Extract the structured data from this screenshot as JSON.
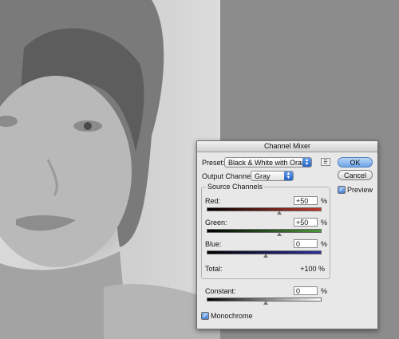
{
  "dialog": {
    "title": "Channel Mixer",
    "preset_label": "Preset:",
    "preset_value": "Black & White with Oran",
    "output_label": "Output Channel:",
    "output_value": "Gray",
    "ok_label": "OK",
    "cancel_label": "Cancel",
    "preview_label": "Preview",
    "preview_checked": true,
    "source_channels_title": "Source Channels",
    "channels": [
      {
        "label": "Red:",
        "value": "+50",
        "unit": "%",
        "level": 50
      },
      {
        "label": "Green:",
        "value": "+50",
        "unit": "%",
        "level": 50
      },
      {
        "label": "Blue:",
        "value": "0",
        "unit": "%",
        "level": 0
      }
    ],
    "total_label": "Total:",
    "total_value": "+100 %",
    "constant_label": "Constant:",
    "constant_value": "0",
    "constant_unit": "%",
    "monochrome_label": "Monochrome",
    "monochrome_checked": true
  },
  "colors": {
    "accent": "#3a78d8",
    "red_slider": "#c0392b",
    "green_slider": "#4c9a3a",
    "blue_slider": "#2c2f9a"
  }
}
